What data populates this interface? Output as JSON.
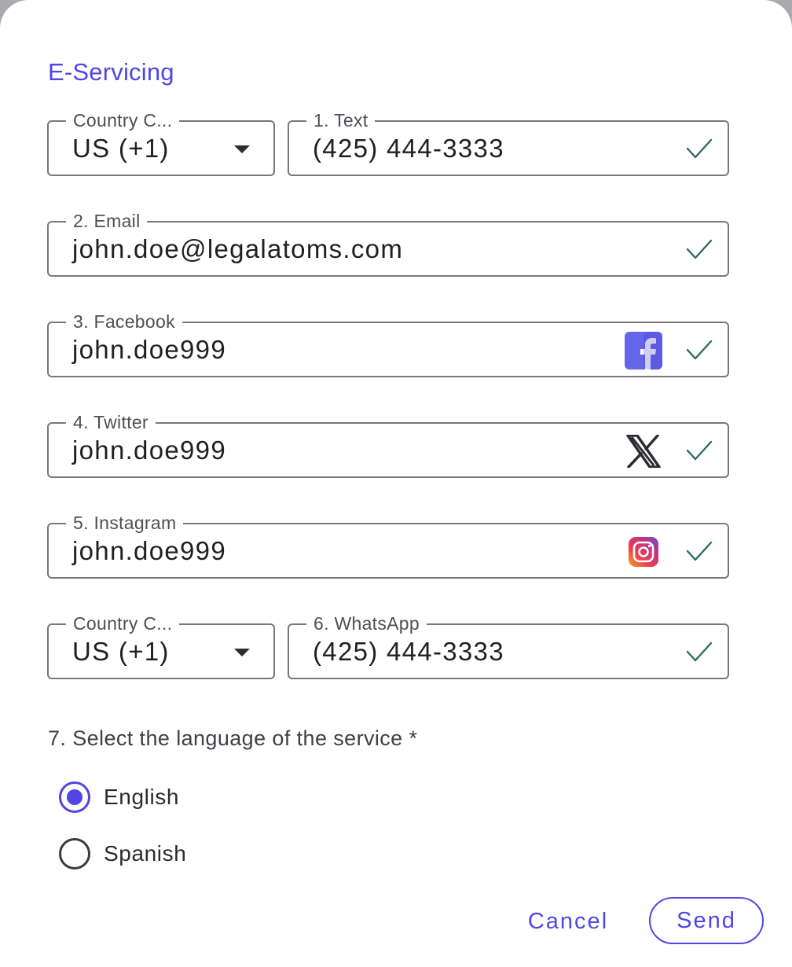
{
  "dialog": {
    "title": "E-Servicing"
  },
  "text_row": {
    "country": {
      "label": "Country C...",
      "value": "US (+1)"
    },
    "phone": {
      "label": "1. Text",
      "value": "(425) 444-3333"
    }
  },
  "email": {
    "label": "2. Email",
    "value": "john.doe@legalatoms.com"
  },
  "facebook": {
    "label": "3. Facebook",
    "value": "john.doe999",
    "icon": "facebook-icon"
  },
  "twitter": {
    "label": "4. Twitter",
    "value": "john.doe999",
    "icon": "x-twitter-icon"
  },
  "instagram": {
    "label": "5. Instagram",
    "value": "john.doe999",
    "icon": "instagram-icon"
  },
  "whatsapp_row": {
    "country": {
      "label": "Country C...",
      "value": "US (+1)"
    },
    "phone": {
      "label": "6. WhatsApp",
      "value": "(425) 444-3333"
    }
  },
  "language": {
    "question": "7. Select the language of the service *",
    "options": [
      {
        "label": "English",
        "selected": true
      },
      {
        "label": "Spanish",
        "selected": false
      }
    ]
  },
  "actions": {
    "cancel_label": "Cancel",
    "send_label": "Send"
  },
  "colors": {
    "accent": "#4f46e5",
    "check": "#2f6b62",
    "border": "#77787d",
    "facebook": "#6366e9"
  }
}
